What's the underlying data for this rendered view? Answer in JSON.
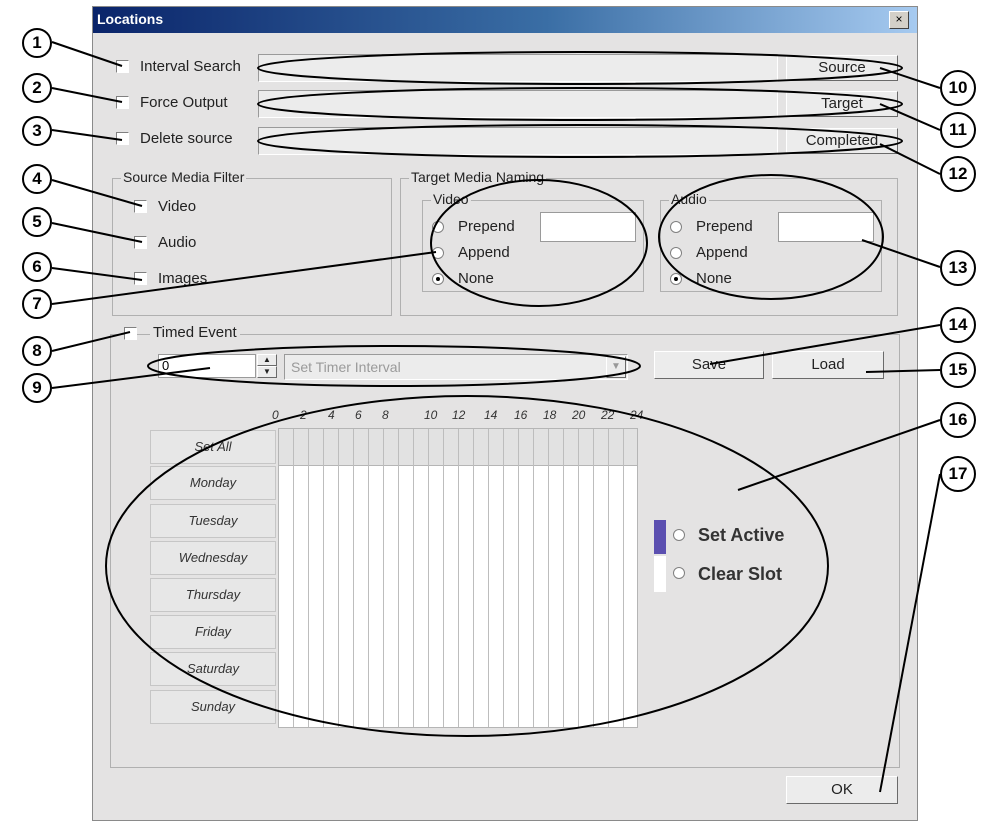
{
  "dialog": {
    "title": "Locations",
    "close_label": "×",
    "ok_label": "OK"
  },
  "options": {
    "interval_search": "Interval Search",
    "force_output": "Force Output",
    "delete_source": "Delete source",
    "source_button": "Source",
    "target_button": "Target",
    "completed_button": "Completed"
  },
  "source_media_filter": {
    "title": "Source Media Filter",
    "video": "Video",
    "audio": "Audio",
    "images": "Images"
  },
  "target_media_naming": {
    "title": "Target Media Naming",
    "video": {
      "title": "Video",
      "prepend": "Prepend",
      "append": "Append",
      "none": "None",
      "selected": "None"
    },
    "audio": {
      "title": "Audio",
      "prepend": "Prepend",
      "append": "Append",
      "none": "None",
      "selected": "None"
    }
  },
  "timed_event": {
    "label": "Timed Event",
    "interval_value": "0",
    "interval_select": "Set Timer Interval",
    "save_label": "Save",
    "load_label": "Load"
  },
  "schedule": {
    "hours": [
      "0",
      "2",
      "4",
      "6",
      "8",
      "10",
      "12",
      "14",
      "16",
      "18",
      "20",
      "22",
      "24"
    ],
    "rows": [
      "Set All",
      "Monday",
      "Tuesday",
      "Wednesday",
      "Thursday",
      "Friday",
      "Saturday",
      "Sunday"
    ],
    "set_active": "Set Active",
    "clear_slot": "Clear Slot",
    "active_color": "#5b4fb0"
  },
  "callouts": [
    "1",
    "2",
    "3",
    "4",
    "5",
    "6",
    "7",
    "8",
    "9",
    "10",
    "11",
    "12",
    "13",
    "14",
    "15",
    "16",
    "17"
  ]
}
